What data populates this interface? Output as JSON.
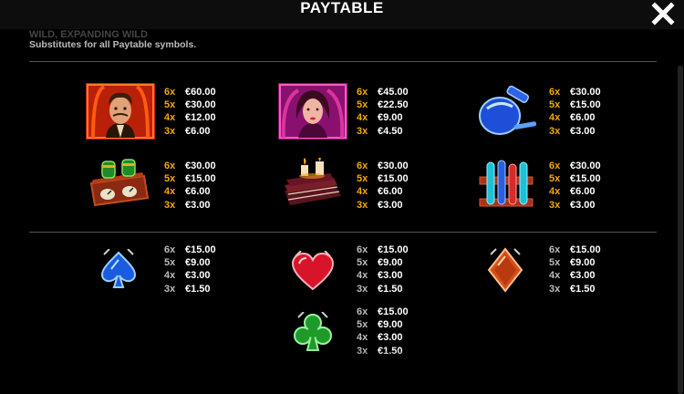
{
  "header": {
    "title": "PAYTABLE",
    "close_icon": "close-icon"
  },
  "wild": {
    "title_faded": "WILD, EXPANDING WILD",
    "description": "Substitutes for all Paytable symbols."
  },
  "high_symbols": [
    {
      "icon": "magician-portrait-icon",
      "pays": [
        {
          "count": "6x",
          "value": "€60.00"
        },
        {
          "count": "5x",
          "value": "€30.00"
        },
        {
          "count": "4x",
          "value": "€12.00"
        },
        {
          "count": "3x",
          "value": "€6.00"
        }
      ]
    },
    {
      "icon": "woman-portrait-icon",
      "pays": [
        {
          "count": "6x",
          "value": "€45.00"
        },
        {
          "count": "5x",
          "value": "€22.50"
        },
        {
          "count": "4x",
          "value": "€9.00"
        },
        {
          "count": "3x",
          "value": "€4.50"
        }
      ]
    },
    {
      "icon": "potion-flask-icon",
      "pays": [
        {
          "count": "6x",
          "value": "€30.00"
        },
        {
          "count": "5x",
          "value": "€15.00"
        },
        {
          "count": "4x",
          "value": "€6.00"
        },
        {
          "count": "3x",
          "value": "€3.00"
        }
      ]
    },
    {
      "icon": "gauge-device-icon",
      "pays": [
        {
          "count": "6x",
          "value": "€30.00"
        },
        {
          "count": "5x",
          "value": "€15.00"
        },
        {
          "count": "4x",
          "value": "€6.00"
        },
        {
          "count": "3x",
          "value": "€3.00"
        }
      ]
    },
    {
      "icon": "books-candles-icon",
      "pays": [
        {
          "count": "6x",
          "value": "€30.00"
        },
        {
          "count": "5x",
          "value": "€15.00"
        },
        {
          "count": "4x",
          "value": "€6.00"
        },
        {
          "count": "3x",
          "value": "€3.00"
        }
      ]
    },
    {
      "icon": "test-tubes-icon",
      "pays": [
        {
          "count": "6x",
          "value": "€30.00"
        },
        {
          "count": "5x",
          "value": "€15.00"
        },
        {
          "count": "4x",
          "value": "€6.00"
        },
        {
          "count": "3x",
          "value": "€3.00"
        }
      ]
    }
  ],
  "low_symbols": [
    {
      "icon": "spade-icon",
      "pays": [
        {
          "count": "6x",
          "value": "€15.00"
        },
        {
          "count": "5x",
          "value": "€9.00"
        },
        {
          "count": "4x",
          "value": "€3.00"
        },
        {
          "count": "3x",
          "value": "€1.50"
        }
      ]
    },
    {
      "icon": "heart-icon",
      "pays": [
        {
          "count": "6x",
          "value": "€15.00"
        },
        {
          "count": "5x",
          "value": "€9.00"
        },
        {
          "count": "4x",
          "value": "€3.00"
        },
        {
          "count": "3x",
          "value": "€1.50"
        }
      ]
    },
    {
      "icon": "diamond-icon",
      "pays": [
        {
          "count": "6x",
          "value": "€15.00"
        },
        {
          "count": "5x",
          "value": "€9.00"
        },
        {
          "count": "4x",
          "value": "€3.00"
        },
        {
          "count": "3x",
          "value": "€1.50"
        }
      ]
    },
    {
      "icon": "club-icon",
      "pays": [
        {
          "count": "6x",
          "value": "€15.00"
        },
        {
          "count": "5x",
          "value": "€9.00"
        },
        {
          "count": "4x",
          "value": "€3.00"
        },
        {
          "count": "3x",
          "value": "€1.50"
        }
      ]
    }
  ],
  "colors": {
    "multiplier_gold": "#f2a900",
    "multiplier_grey": "#bbbbbb",
    "divider": "#555555"
  }
}
